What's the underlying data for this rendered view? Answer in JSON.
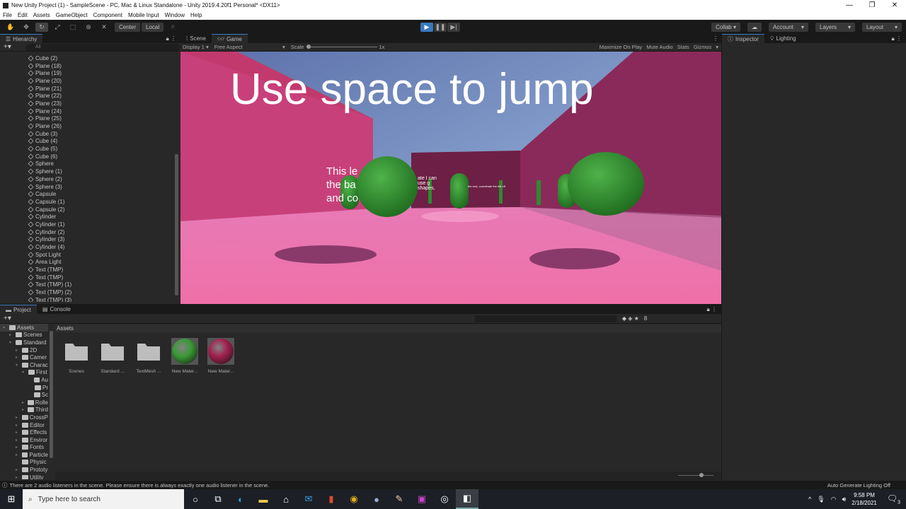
{
  "window": {
    "title": "New Unity Project (1) - SampleScene - PC, Mac & Linux Standalone - Unity 2019.4.20f1 Personal* <DX11>"
  },
  "menu": [
    "File",
    "Edit",
    "Assets",
    "GameObject",
    "Component",
    "Mobile Input",
    "Window",
    "Help"
  ],
  "toolbar": {
    "center": "Center",
    "local": "Local",
    "collab": "Collab",
    "account": "Account",
    "layers": "Layers",
    "layout": "Layout"
  },
  "hierarchy": {
    "title": "Hierarchy",
    "search_placeholder": "All",
    "items": [
      "Cube (2)",
      "Plane (18)",
      "Plane (19)",
      "Plane (20)",
      "Plane (21)",
      "Plane (22)",
      "Plane (23)",
      "Plane (24)",
      "Plane (25)",
      "Plane (26)",
      "Cube (3)",
      "Cube (4)",
      "Cube (5)",
      "Cube (6)",
      "Sphere",
      "Sphere (1)",
      "Sphere (2)",
      "Sphere (3)",
      "Capsule",
      "Capsule (1)",
      "Capsule (2)",
      "Cylinder",
      "Cylinder (1)",
      "Cylinder (2)",
      "Cylinder (3)",
      "Cylinder (4)",
      "Spot Light",
      "Area Light",
      "Text (TMP)",
      "Text (TMP)",
      "Text (TMP) (1)",
      "Text (TMP) (2)",
      "Text (TMP) (3)"
    ]
  },
  "game": {
    "tabs": [
      "Scene",
      "Game"
    ],
    "display": "Display 1",
    "aspect": "Free Aspect",
    "scale_label": "Scale",
    "scale_value": "1x",
    "options": [
      "Maximize On Play",
      "Mute Audio",
      "Stats",
      "Gizmos"
    ],
    "headline": "Use space to jump",
    "sign_text": [
      "This le",
      "the ba",
      "and co"
    ],
    "far_text": "ate I can use g shapes,",
    "far_text2": "the end, coordinate the left off"
  },
  "inspector": {
    "tabs": [
      "Inspector",
      "Lighting"
    ]
  },
  "project": {
    "tabs": [
      "Project",
      "Console"
    ],
    "breadcrumb": "Assets",
    "tree": [
      {
        "label": "Assets",
        "d": 0
      },
      {
        "label": "Scenes",
        "d": 1
      },
      {
        "label": "Standard",
        "d": 1
      },
      {
        "label": "2D",
        "d": 2
      },
      {
        "label": "Camer",
        "d": 2
      },
      {
        "label": "Charac",
        "d": 2
      },
      {
        "label": "First",
        "d": 3
      },
      {
        "label": "Au",
        "d": 4
      },
      {
        "label": "Pr",
        "d": 4
      },
      {
        "label": "Sc",
        "d": 4
      },
      {
        "label": "Rolle",
        "d": 3
      },
      {
        "label": "Third",
        "d": 3
      },
      {
        "label": "CrossP",
        "d": 2
      },
      {
        "label": "Editor",
        "d": 2
      },
      {
        "label": "Effects",
        "d": 2
      },
      {
        "label": "Enviror",
        "d": 2
      },
      {
        "label": "Fonts",
        "d": 2
      },
      {
        "label": "Particle",
        "d": 2
      },
      {
        "label": "Physic",
        "d": 2
      },
      {
        "label": "Prototy",
        "d": 2
      },
      {
        "label": "Utility",
        "d": 2
      }
    ],
    "assets": [
      {
        "label": "Scenes",
        "type": "folder"
      },
      {
        "label": "Standard ...",
        "type": "folder"
      },
      {
        "label": "TextMesh ...",
        "type": "folder"
      },
      {
        "label": "New Mater...",
        "type": "material",
        "color": "#3a9a35"
      },
      {
        "label": "New Mater...",
        "type": "material",
        "color": "#a3204f"
      }
    ],
    "badge": "8"
  },
  "status": {
    "message": "There are 2 audio listeners in the scene. Please ensure there is always exactly one audio listener in the scene.",
    "lighting": "Auto Generate Lighting Off"
  },
  "taskbar": {
    "search_placeholder": "Type here to search",
    "time": "9:58 PM",
    "date": "2/18/2021",
    "notifications": "3"
  }
}
